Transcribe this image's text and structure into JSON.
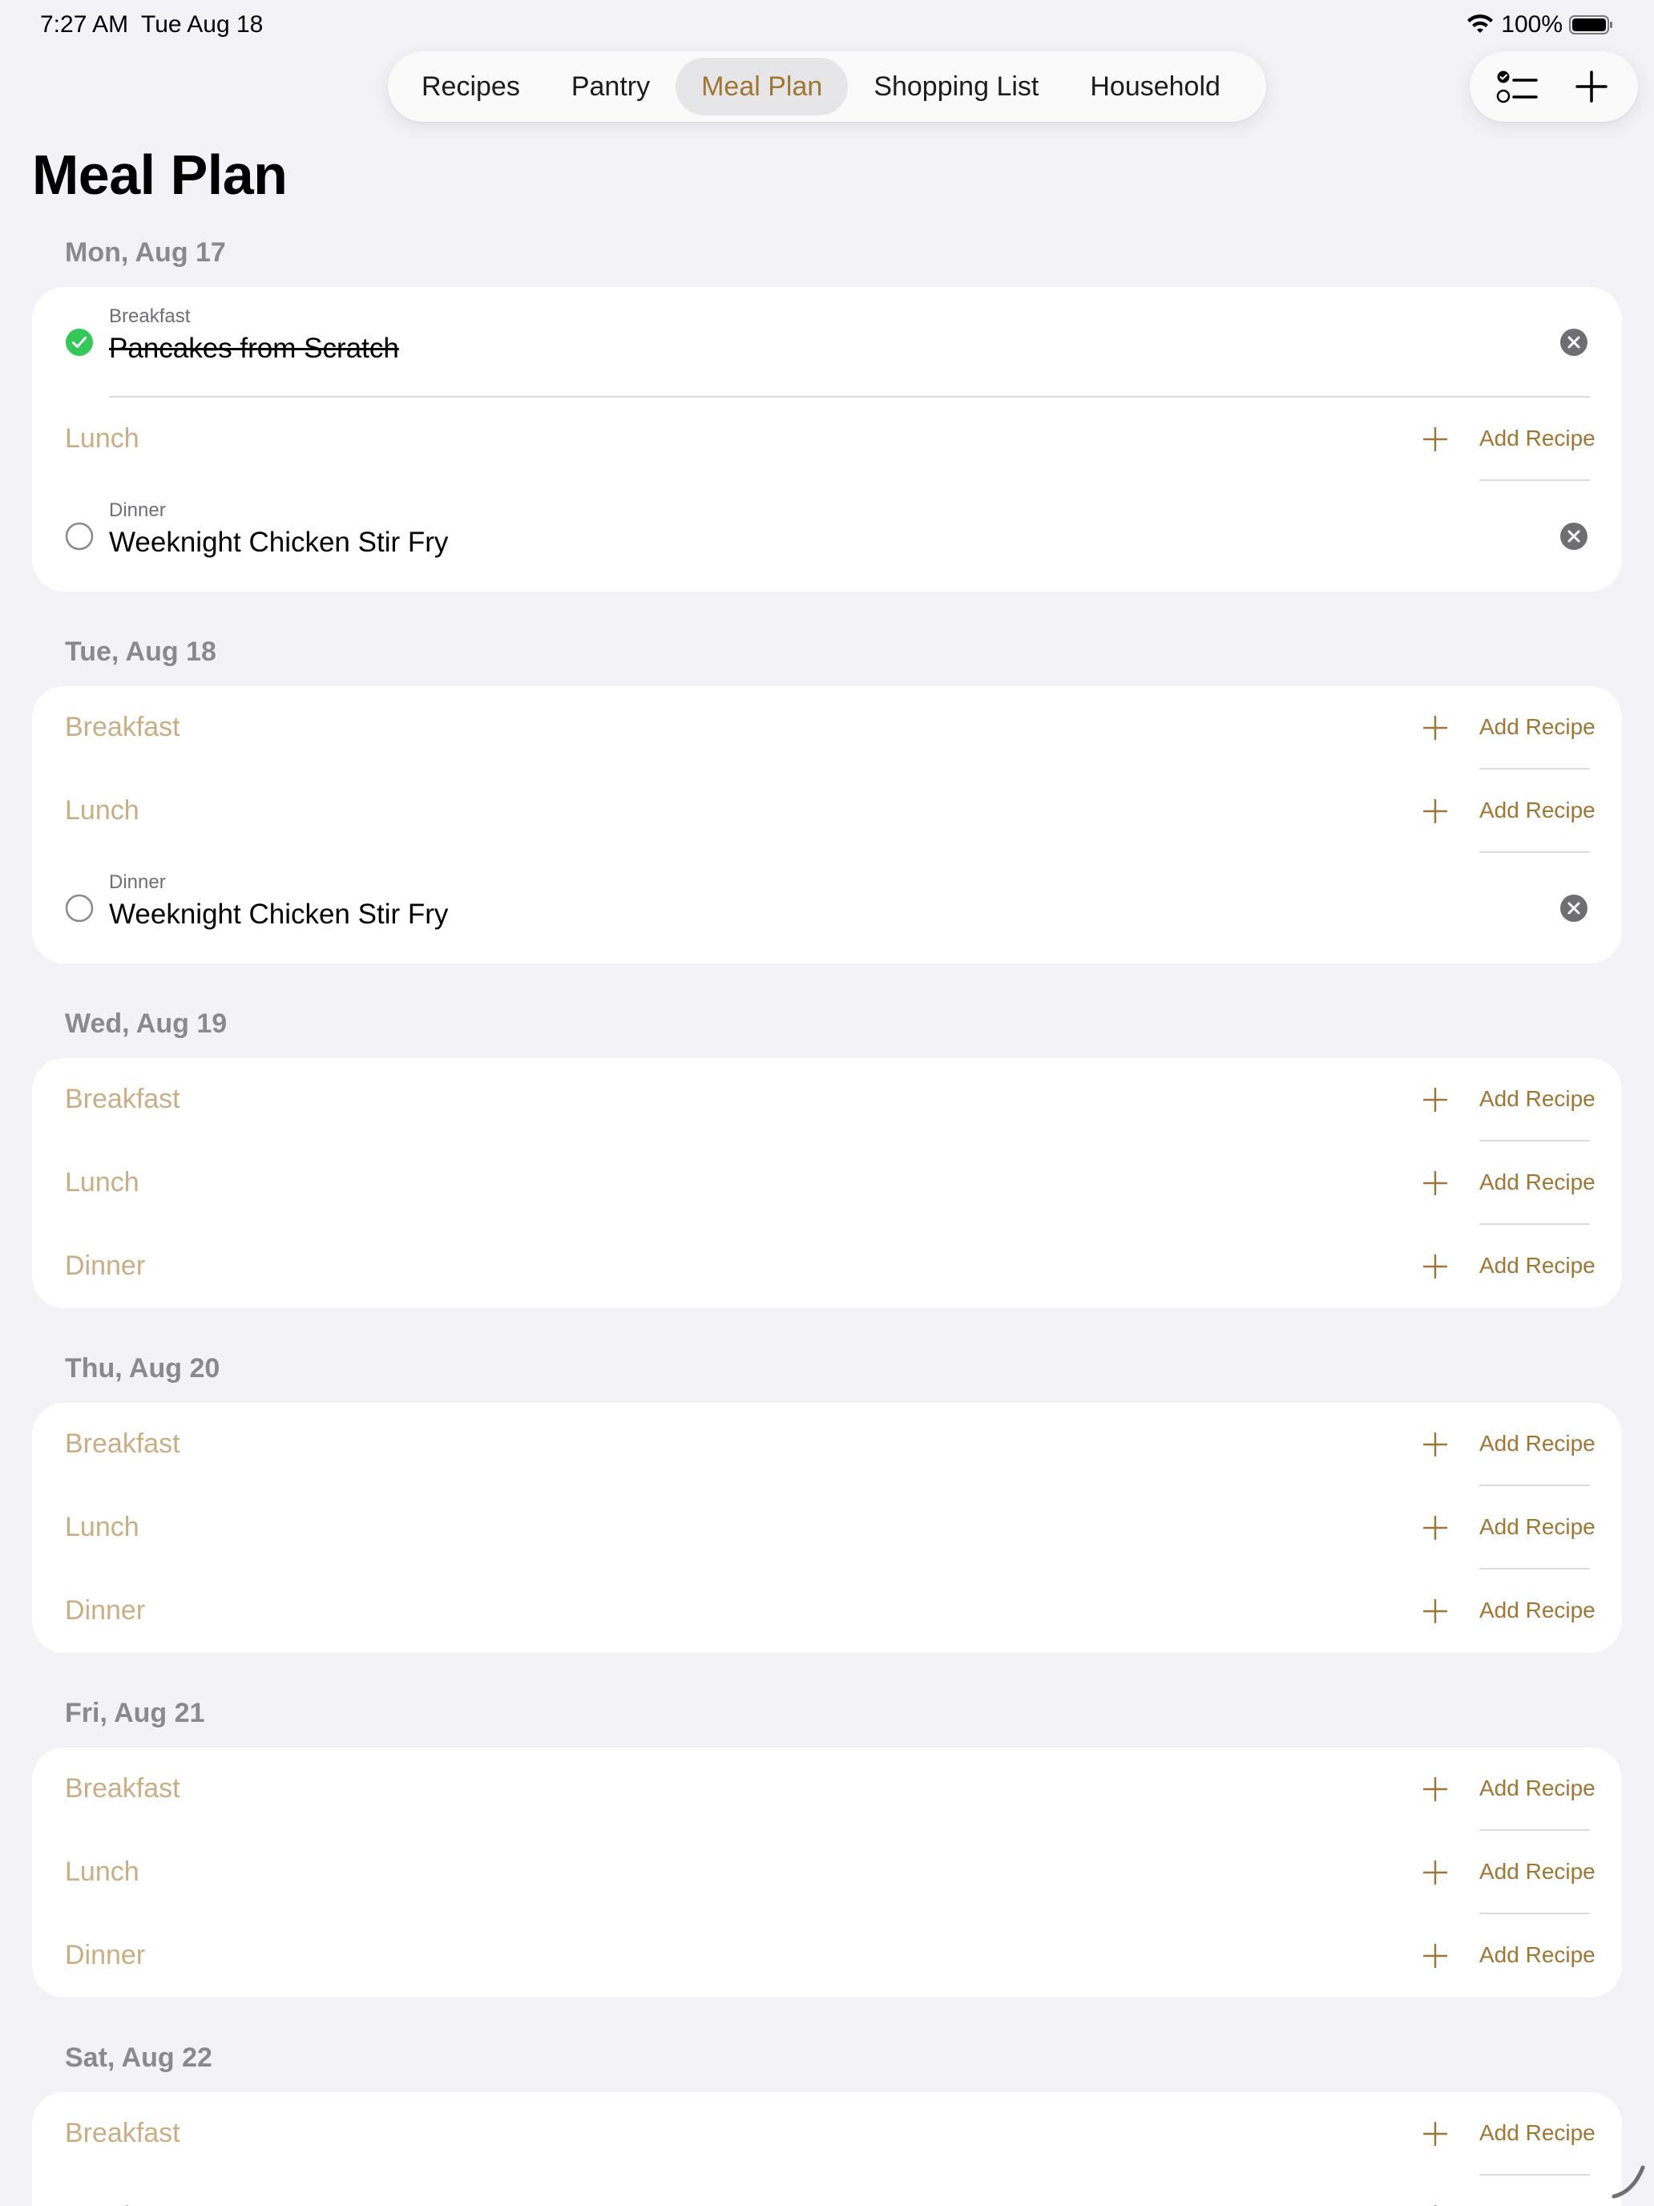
{
  "status": {
    "time": "7:27 AM",
    "date": "Tue Aug 18",
    "battery": "100%",
    "icons": [
      "wifi-icon",
      "battery-icon"
    ]
  },
  "tabs": [
    {
      "label": "Recipes",
      "active": false
    },
    {
      "label": "Pantry",
      "active": false
    },
    {
      "label": "Meal Plan",
      "active": true
    },
    {
      "label": "Shopping List",
      "active": false
    },
    {
      "label": "Household",
      "active": false
    }
  ],
  "toolbar": {
    "icons": [
      "checklist-icon",
      "plus-icon"
    ]
  },
  "page_title": "Meal Plan",
  "add_label": "Add Recipe",
  "colors": {
    "accent": "#a07634",
    "placeholder": "#c9ad85",
    "check_green": "#34c759",
    "background": "#f2f2f7"
  },
  "days": [
    {
      "label": "Mon, Aug 17",
      "meals": [
        {
          "type": "Breakfast",
          "recipe": "Pancakes from Scratch",
          "done": true
        },
        {
          "type": "Lunch",
          "recipe": null
        },
        {
          "type": "Dinner",
          "recipe": "Weeknight Chicken Stir Fry",
          "done": false
        }
      ]
    },
    {
      "label": "Tue, Aug 18",
      "meals": [
        {
          "type": "Breakfast",
          "recipe": null
        },
        {
          "type": "Lunch",
          "recipe": null
        },
        {
          "type": "Dinner",
          "recipe": "Weeknight Chicken Stir Fry",
          "done": false
        }
      ]
    },
    {
      "label": "Wed, Aug 19",
      "meals": [
        {
          "type": "Breakfast",
          "recipe": null
        },
        {
          "type": "Lunch",
          "recipe": null
        },
        {
          "type": "Dinner",
          "recipe": null
        }
      ]
    },
    {
      "label": "Thu, Aug 20",
      "meals": [
        {
          "type": "Breakfast",
          "recipe": null
        },
        {
          "type": "Lunch",
          "recipe": null
        },
        {
          "type": "Dinner",
          "recipe": null
        }
      ]
    },
    {
      "label": "Fri, Aug 21",
      "meals": [
        {
          "type": "Breakfast",
          "recipe": null
        },
        {
          "type": "Lunch",
          "recipe": null
        },
        {
          "type": "Dinner",
          "recipe": null
        }
      ]
    },
    {
      "label": "Sat, Aug 22",
      "meals": [
        {
          "type": "Breakfast",
          "recipe": null
        },
        {
          "type": "Lunch",
          "recipe": null
        }
      ]
    }
  ]
}
